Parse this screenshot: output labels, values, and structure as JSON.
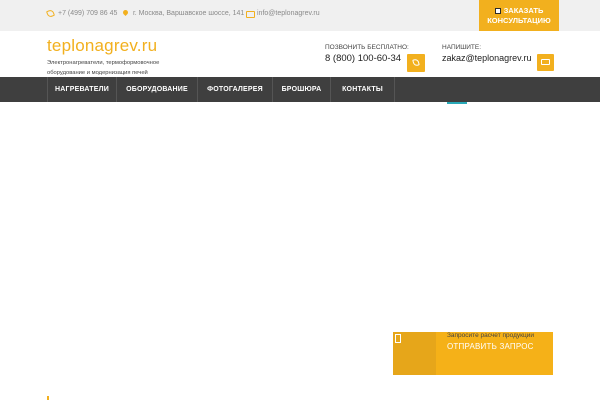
{
  "topbar": {
    "phone": "+7 (499) 709 86 45",
    "address": "г. Москва, Варшавское шоссе, 141",
    "email": "info@teplonagrev.ru",
    "consult_line1": "ЗАКАЗАТЬ",
    "consult_line2": "КОНСУЛЬТАЦИЮ"
  },
  "header": {
    "logo": "teplonagrev.ru",
    "tagline": "Электронагреватели, термоформовочное оборудование и модернизация печей",
    "call_label": "ПОЗВОНИТЬ БЕСПЛАТНО:",
    "call_number": "8 (800) 100-60-34",
    "write_label": "НАПИШИТЕ:",
    "write_email": "zakaz@teplonagrev.ru"
  },
  "nav": {
    "items": [
      "НАГРЕВАТЕЛИ",
      "ОБОРУДОВАНИЕ",
      "ФОТОГАЛЕРЕЯ",
      "БРОШЮРА",
      "КОНТАКТЫ"
    ]
  },
  "request": {
    "caption": "Запросите расчет продукции",
    "action": "ОТПРАВИТЬ ЗАПРОС"
  },
  "colors": {
    "accent": "#f2b01e",
    "nav_bg": "#3f3f3f",
    "topbar_bg": "#f0f0f0"
  },
  "icons": [
    "phone-icon",
    "map-pin-icon",
    "mail-icon",
    "pencil-icon",
    "call-icon",
    "envelope-icon"
  ]
}
